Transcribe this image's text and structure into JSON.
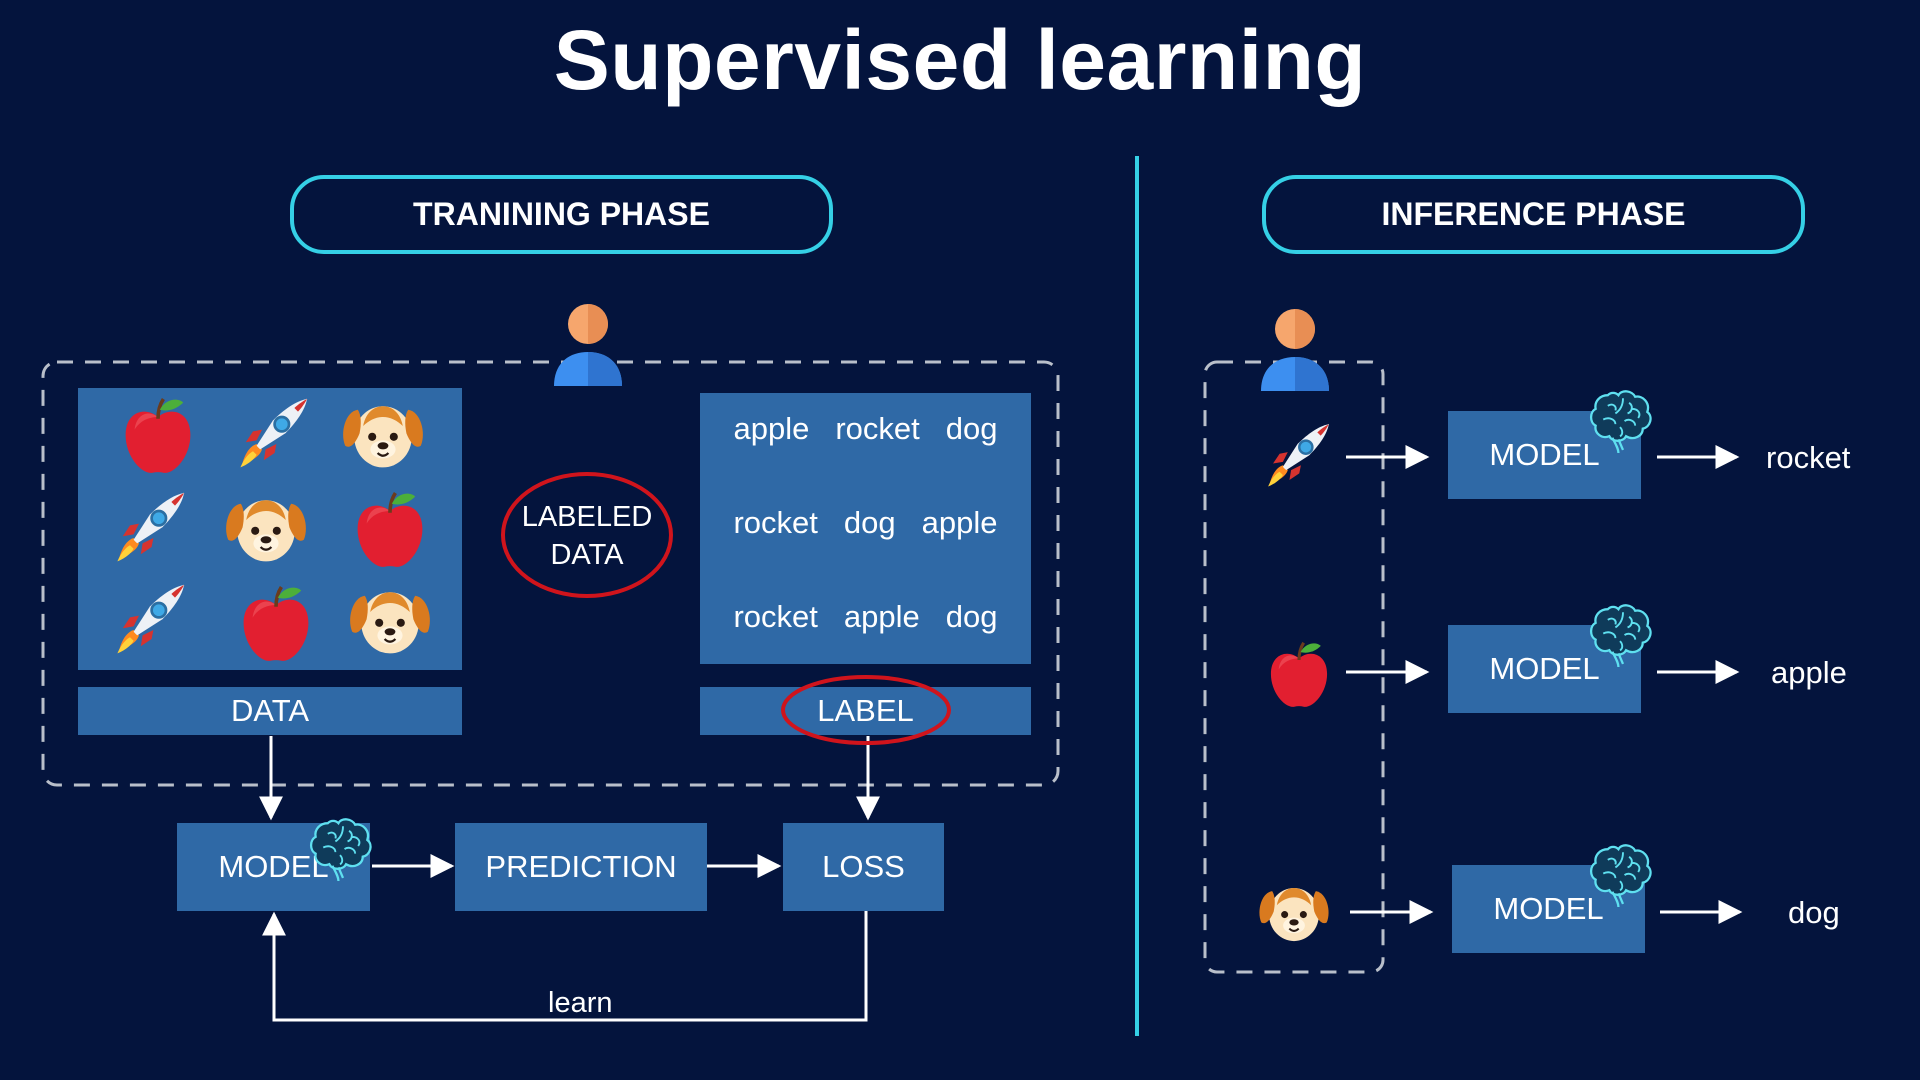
{
  "title": "Supervised learning",
  "training": {
    "phase_label": "TRANINING PHASE",
    "data_caption": "DATA",
    "label_caption": "LABEL",
    "labeled_data": [
      "LABELED",
      "DATA"
    ],
    "data_grid": [
      [
        "apple-icon",
        "rocket-icon",
        "dog-icon"
      ],
      [
        "rocket-icon",
        "dog-icon",
        "apple-icon"
      ],
      [
        "rocket-icon",
        "apple-icon",
        "dog-icon"
      ]
    ],
    "label_rows": [
      [
        "apple",
        "rocket",
        "dog"
      ],
      [
        "rocket",
        "dog",
        "apple"
      ],
      [
        "rocket",
        "apple",
        "dog"
      ]
    ],
    "model": "MODEL",
    "prediction": "PREDICTION",
    "loss": "LOSS",
    "learn": "learn"
  },
  "inference": {
    "phase_label": "INFERENCE PHASE",
    "rows": [
      {
        "input_icon": "rocket-icon",
        "model": "MODEL",
        "output": "rocket"
      },
      {
        "input_icon": "apple-icon",
        "model": "MODEL",
        "output": "apple"
      },
      {
        "input_icon": "dog-icon",
        "model": "MODEL",
        "output": "dog"
      }
    ]
  },
  "colors": {
    "background": "#04143d",
    "box": "#2f69a6",
    "accent": "#35d0e6",
    "highlight": "#d0141c",
    "dashed": "#b9bfca"
  }
}
